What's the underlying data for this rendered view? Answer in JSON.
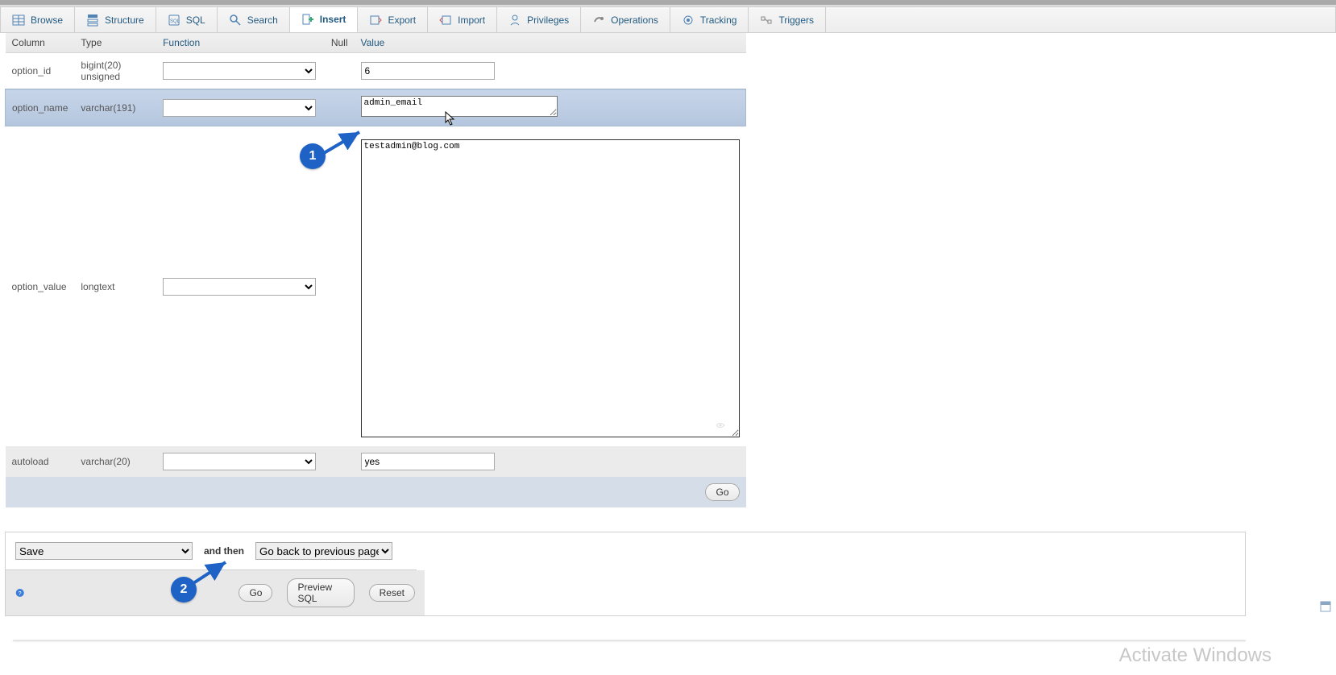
{
  "tabs": [
    {
      "label": "Browse"
    },
    {
      "label": "Structure"
    },
    {
      "label": "SQL"
    },
    {
      "label": "Search"
    },
    {
      "label": "Insert",
      "active": true
    },
    {
      "label": "Export"
    },
    {
      "label": "Import"
    },
    {
      "label": "Privileges"
    },
    {
      "label": "Operations"
    },
    {
      "label": "Tracking"
    },
    {
      "label": "Triggers"
    }
  ],
  "headers": {
    "column": "Column",
    "type": "Type",
    "func": "Function",
    "null": "Null",
    "value": "Value"
  },
  "rows": [
    {
      "column": "option_id",
      "type": "bigint(20) unsigned",
      "value": "6",
      "input_kind": "text"
    },
    {
      "column": "option_name",
      "type": "varchar(191)",
      "value": "admin_email",
      "input_kind": "textarea_small"
    },
    {
      "column": "option_value",
      "type": "longtext",
      "value": "testadmin@blog.com",
      "input_kind": "textarea_large"
    },
    {
      "column": "autoload",
      "type": "varchar(20)",
      "value": "yes",
      "input_kind": "text"
    }
  ],
  "go_button": "Go",
  "footer": {
    "save_options": [
      "Save"
    ],
    "save_selected": "Save",
    "and_then_label": "and then",
    "then_options": [
      "Go back to previous page"
    ],
    "then_selected": "Go back to previous page",
    "go": "Go",
    "preview": "Preview SQL",
    "reset": "Reset"
  },
  "callouts": {
    "1": "1",
    "2": "2"
  },
  "watermark": "Activate Windows"
}
